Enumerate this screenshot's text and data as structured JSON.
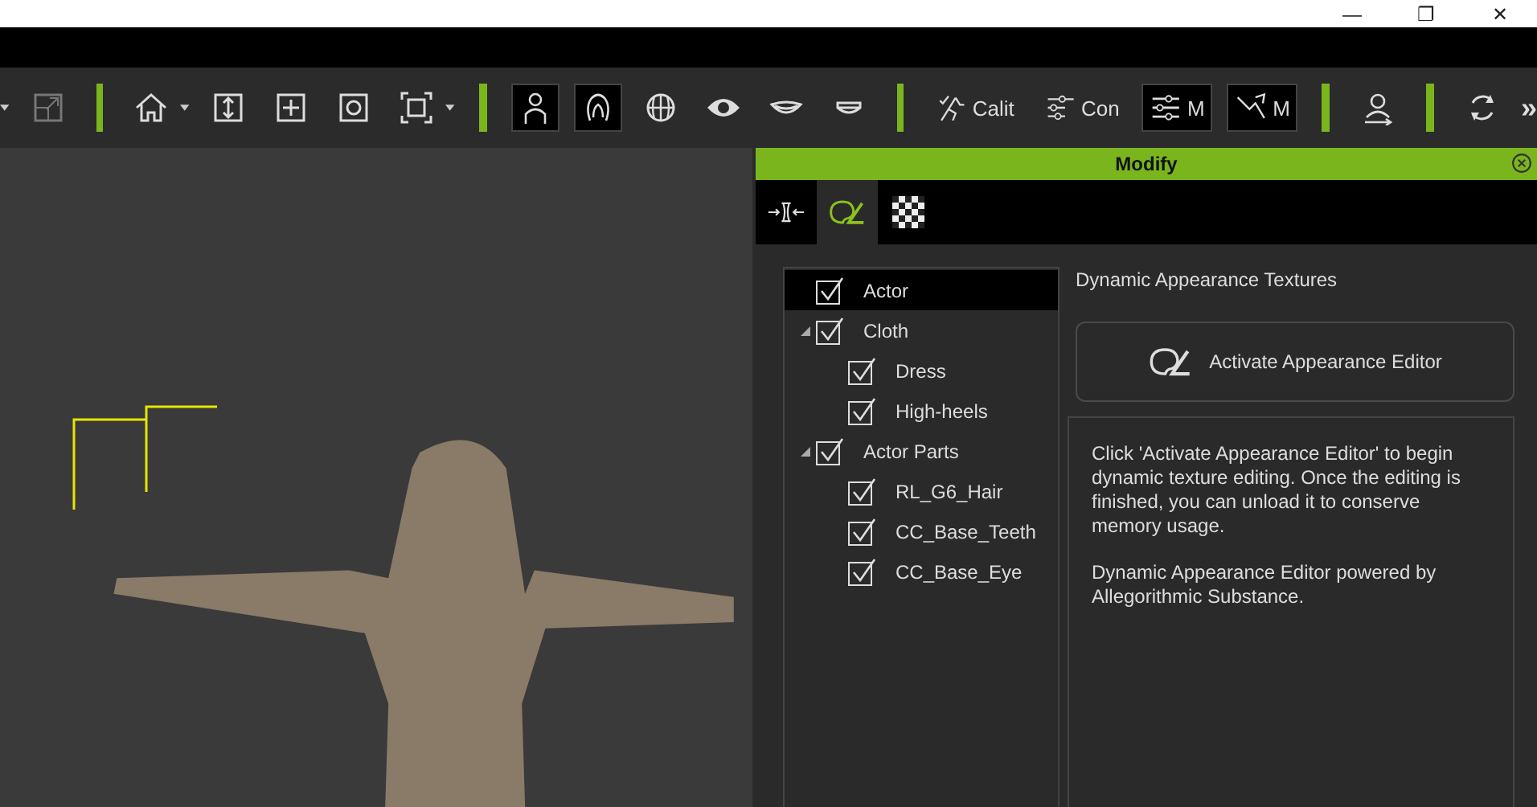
{
  "window": {
    "controls": [
      "—",
      "❐",
      "✕"
    ]
  },
  "toolbar": [
    {
      "kind": "caret"
    },
    {
      "kind": "icon",
      "selected": false
    },
    {
      "kind": "separator"
    },
    {
      "kind": "icon",
      "selected": false
    },
    {
      "kind": "caret"
    },
    {
      "kind": "icon",
      "selected": false
    },
    {
      "kind": "icon",
      "selected": false
    },
    {
      "kind": "icon",
      "selected": false
    },
    {
      "kind": "icon",
      "selected": false
    },
    {
      "kind": "caret"
    },
    {
      "kind": "separator"
    },
    {
      "kind": "icon",
      "selected": true
    },
    {
      "kind": "icon",
      "selected": true
    },
    {
      "kind": "icon",
      "selected": false
    },
    {
      "kind": "icon",
      "selected": false
    },
    {
      "kind": "icon",
      "selected": false
    },
    {
      "kind": "icon",
      "selected": false
    },
    {
      "kind": "separator"
    },
    {
      "kind": "label",
      "label": "Calit",
      "selected": false
    },
    {
      "kind": "label",
      "label": "Con",
      "selected": false
    },
    {
      "kind": "label",
      "label": "M",
      "selected": true
    },
    {
      "kind": "label",
      "label": "M",
      "selected": true
    },
    {
      "kind": "separator"
    },
    {
      "kind": "icon",
      "selected": false
    },
    {
      "kind": "separator"
    },
    {
      "kind": "icon",
      "selected": false
    },
    {
      "kind": "more",
      "label": "»"
    }
  ],
  "panel": {
    "title": "Modify",
    "tabs": [
      {
        "selected": false
      },
      {
        "selected": true
      },
      {
        "selected": false
      }
    ],
    "tree": [
      {
        "label": "Actor",
        "checked": true,
        "selected": true,
        "expanded": false
      },
      {
        "label": "Cloth",
        "checked": true,
        "selected": false,
        "expanded": true,
        "children": [
          {
            "label": "Dress",
            "checked": true,
            "selected": false
          },
          {
            "label": "High-heels",
            "checked": true,
            "selected": false
          }
        ]
      },
      {
        "label": "Actor Parts",
        "checked": true,
        "selected": false,
        "expanded": true,
        "children": [
          {
            "label": "RL_G6_Hair",
            "checked": true,
            "selected": false
          },
          {
            "label": "CC_Base_Teeth",
            "checked": true,
            "selected": false
          },
          {
            "label": "CC_Base_Eye",
            "checked": true,
            "selected": false
          }
        ]
      }
    ],
    "section_title": "Dynamic Appearance Textures",
    "activate_button": "Activate Appearance Editor",
    "description": [
      "Click 'Activate Appearance Editor' to begin dynamic texture editing.  Once the editing is finished, you can unload it to conserve memory usage.",
      "Dynamic Appearance Editor powered by Allegorithmic Substance."
    ]
  }
}
